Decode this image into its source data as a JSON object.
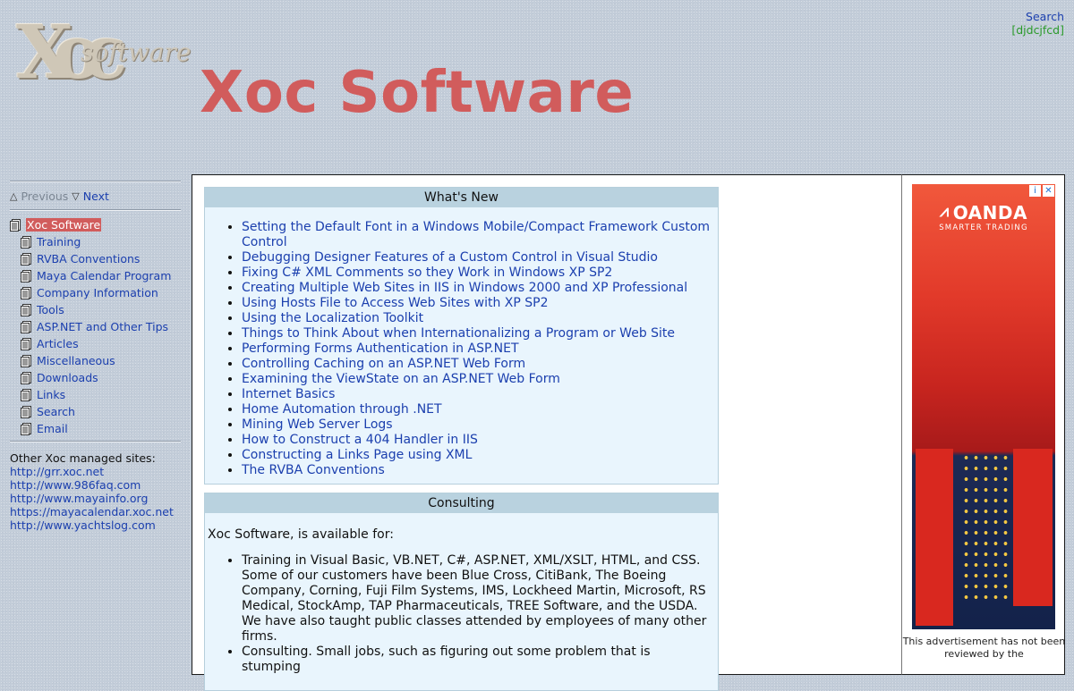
{
  "header": {
    "logo_mark": "Xoc",
    "logo_text": "software",
    "site_title": "Xoc Software",
    "search_link": "Search",
    "code": "[djdcjfcd]"
  },
  "sidebar": {
    "prev_label": "Previous",
    "next_label": "Next",
    "nav": [
      {
        "label": "Xoc Software",
        "current": true
      },
      {
        "label": "Training"
      },
      {
        "label": "RVBA Conventions"
      },
      {
        "label": "Maya Calendar Program"
      },
      {
        "label": "Company Information"
      },
      {
        "label": "Tools"
      },
      {
        "label": "ASP.NET and Other Tips"
      },
      {
        "label": "Articles"
      },
      {
        "label": "Miscellaneous"
      },
      {
        "label": "Downloads"
      },
      {
        "label": "Links"
      },
      {
        "label": "Search"
      },
      {
        "label": "Email"
      }
    ],
    "other_sites_label": "Other Xoc managed sites:",
    "other_sites": [
      "http://grr.xoc.net",
      "http://www.986faq.com",
      "http://www.mayainfo.org",
      "https://mayacalendar.xoc.net",
      "http://www.yachtslog.com"
    ]
  },
  "whats_new": {
    "heading": "What's New",
    "items": [
      "Setting the Default Font in a Windows Mobile/Compact Framework Custom Control",
      "Debugging Designer Features of a Custom Control in Visual Studio",
      "Fixing C# XML Comments so they Work in Windows XP SP2",
      "Creating Multiple Web Sites in IIS in Windows 2000 and XP Professional",
      "Using Hosts File to Access Web Sites with XP SP2",
      "Using the Localization Toolkit",
      "Things to Think About when Internationalizing a Program or Web Site",
      "Performing Forms Authentication in ASP.NET",
      "Controlling Caching on an ASP.NET Web Form",
      "Examining the ViewState on an ASP.NET Web Form",
      "Internet Basics",
      "Home Automation through .NET",
      "Mining Web Server Logs",
      "How to Construct a 404 Handler in IIS",
      "Constructing a Links Page using XML",
      "The RVBA Conventions"
    ]
  },
  "consulting": {
    "heading": "Consulting",
    "intro": "Xoc Software, is available for:",
    "items": [
      "Training in Visual Basic, VB.NET, C#, ASP.NET, XML/XSLT, HTML, and CSS. Some of our customers have been Blue Cross, CitiBank, The Boeing Company, Corning, Fuji Film Systems, IMS, Lockheed Martin, Microsoft, RS Medical, StockAmp, TAP Pharmaceuticals, TREE Software, and the USDA. We have also taught public classes attended by employees of many other firms.",
      "Consulting. Small jobs, such as figuring out some problem that is stumping"
    ]
  },
  "ad": {
    "brand": "OANDA",
    "tagline": "SMARTER TRADING",
    "note": "This advertisement has not been reviewed by the"
  }
}
